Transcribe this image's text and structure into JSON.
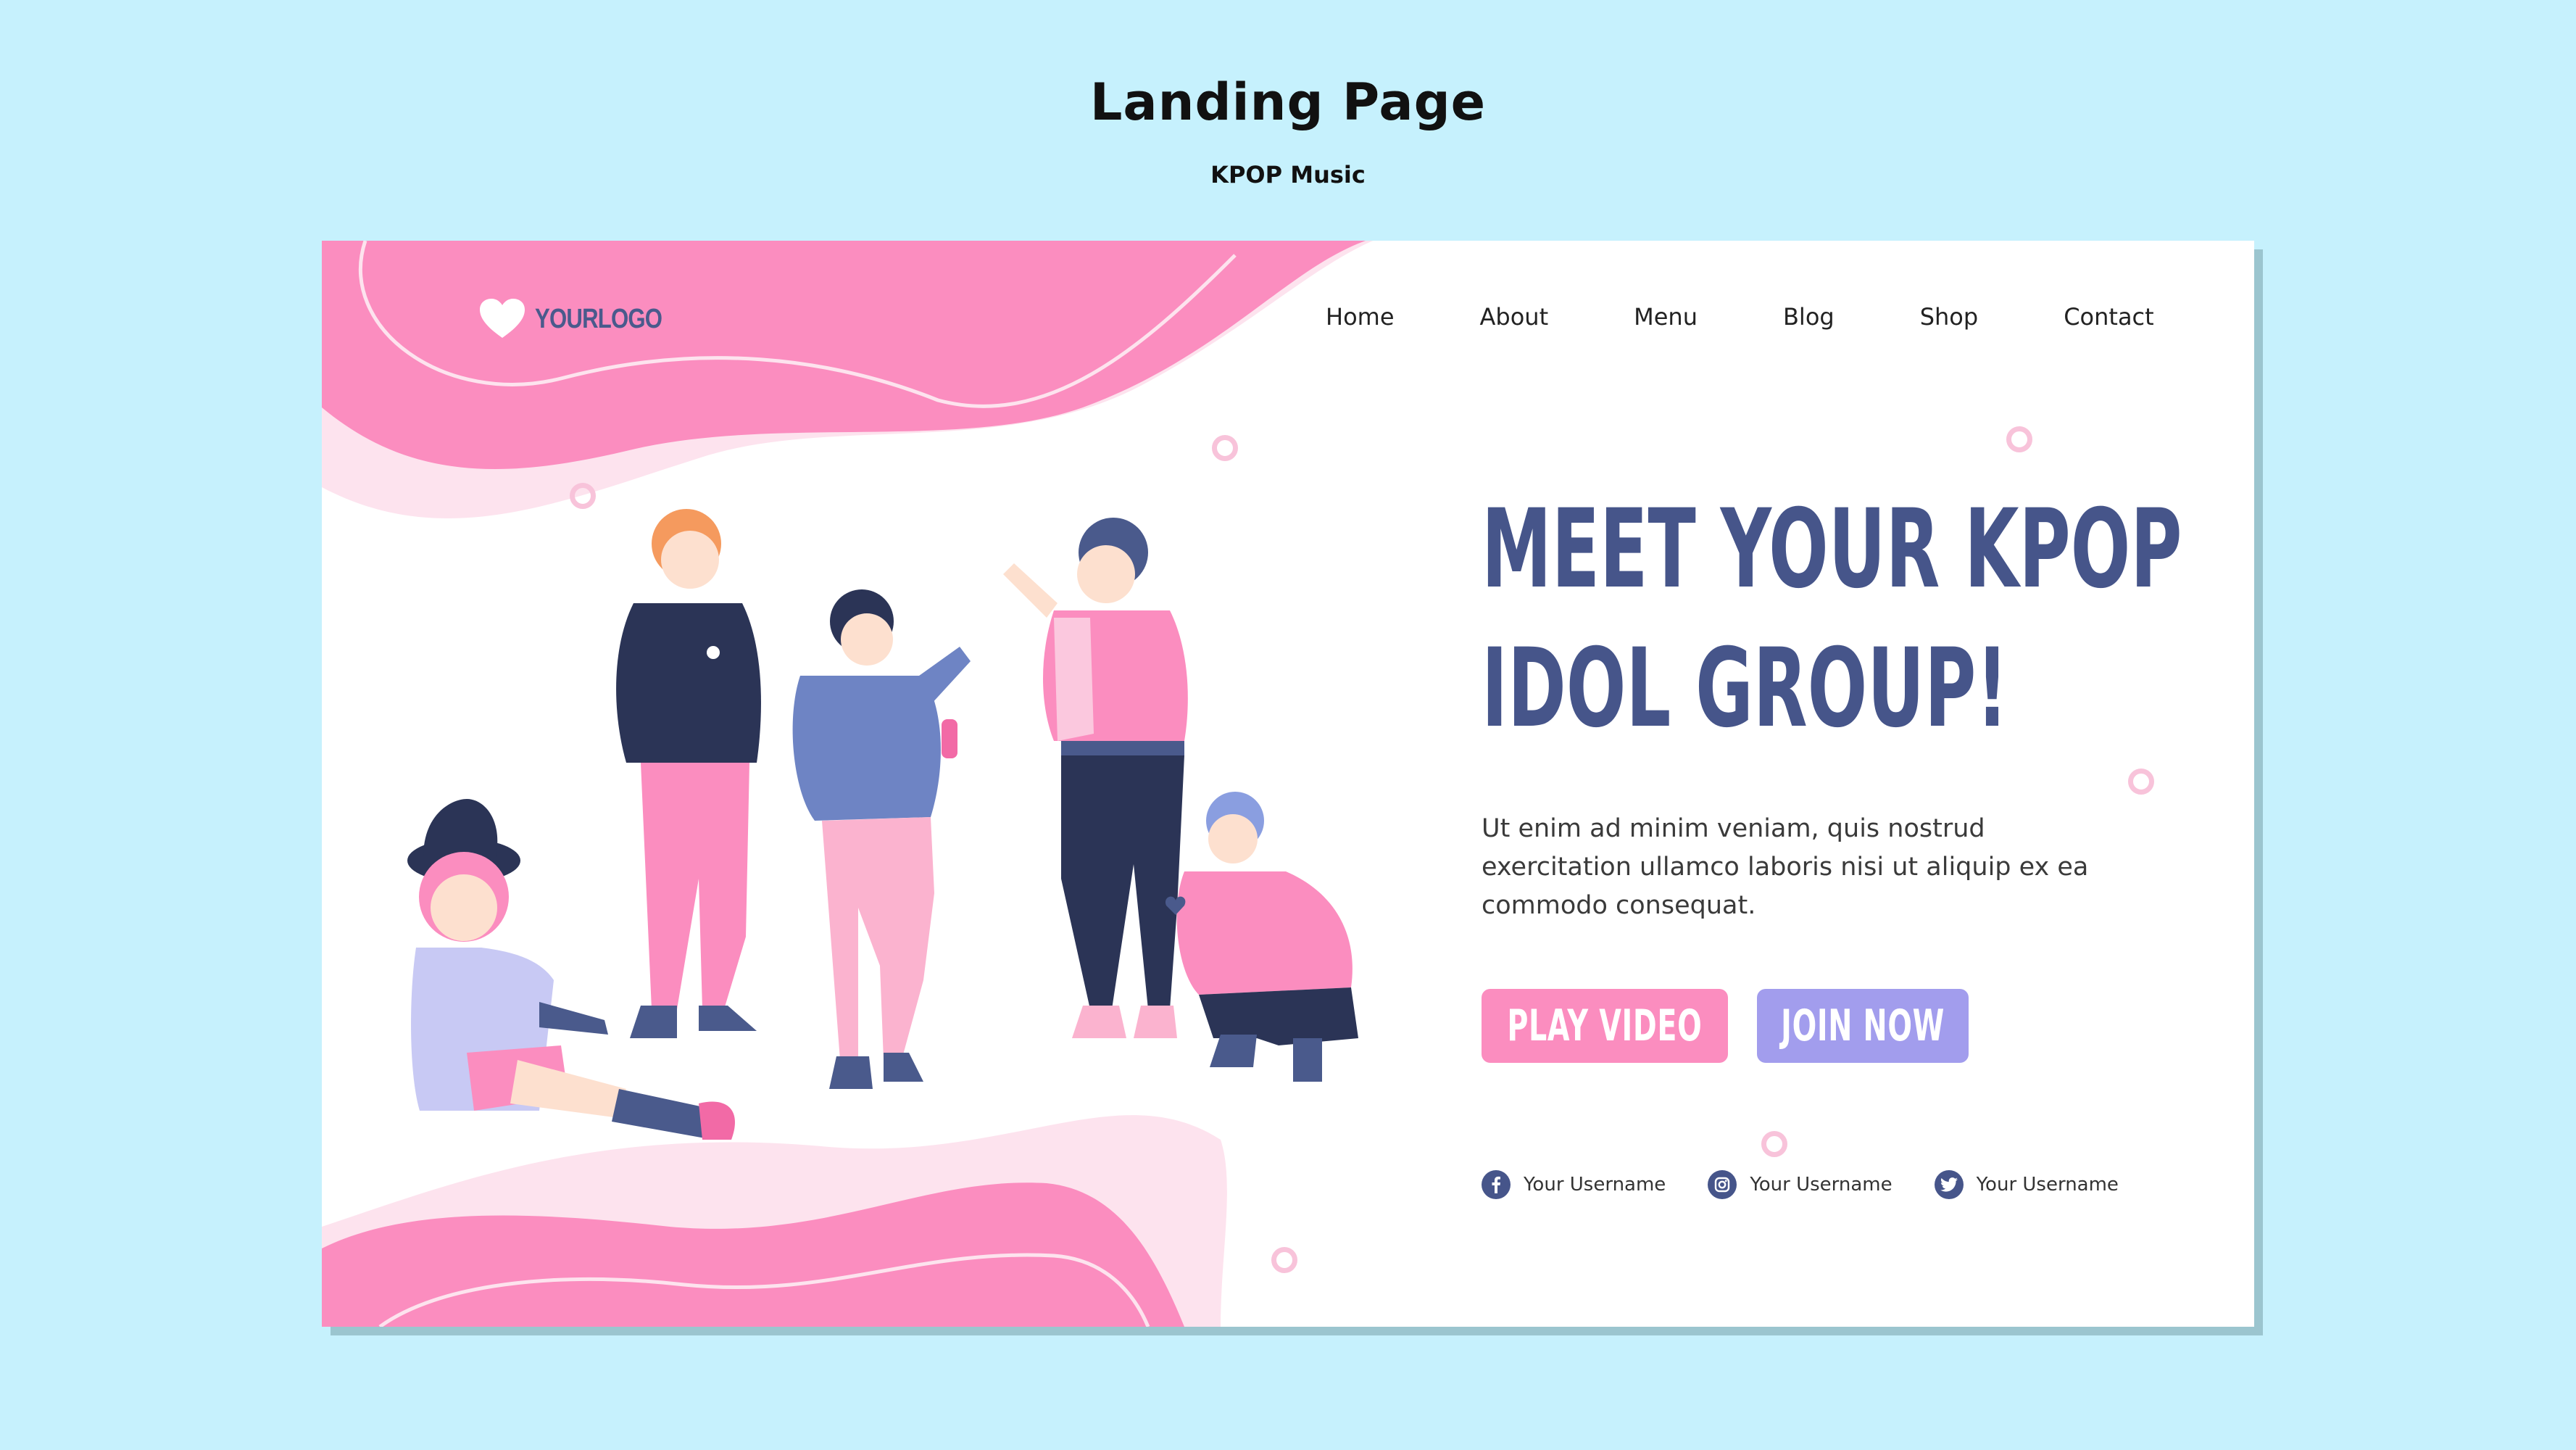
{
  "page": {
    "title": "Landing Page",
    "subtitle": "KPOP Music"
  },
  "brand": {
    "logo_text": "YOURLOGO"
  },
  "nav": {
    "items": [
      "Home",
      "About",
      "Menu",
      "Blog",
      "Shop",
      "Contact"
    ]
  },
  "hero": {
    "title_line1": "MEET YOUR KPOP",
    "title_line2": "IDOL GROUP!",
    "body": "Ut enim ad minim veniam, quis nostrud exercitation ullamco laboris nisi ut aliquip ex ea commodo consequat."
  },
  "buttons": {
    "play_label": "PLAY VIDEO",
    "join_label": "JOIN NOW"
  },
  "socials": [
    {
      "icon": "facebook-icon",
      "label": "Your Username"
    },
    {
      "icon": "instagram-icon",
      "label": "Your Username"
    },
    {
      "icon": "twitter-icon",
      "label": "Your Username"
    }
  ],
  "colors": {
    "background": "#c6f1fd",
    "heading": "#46558a",
    "pink": "#fb8dbf",
    "lavender": "#a29ded"
  }
}
